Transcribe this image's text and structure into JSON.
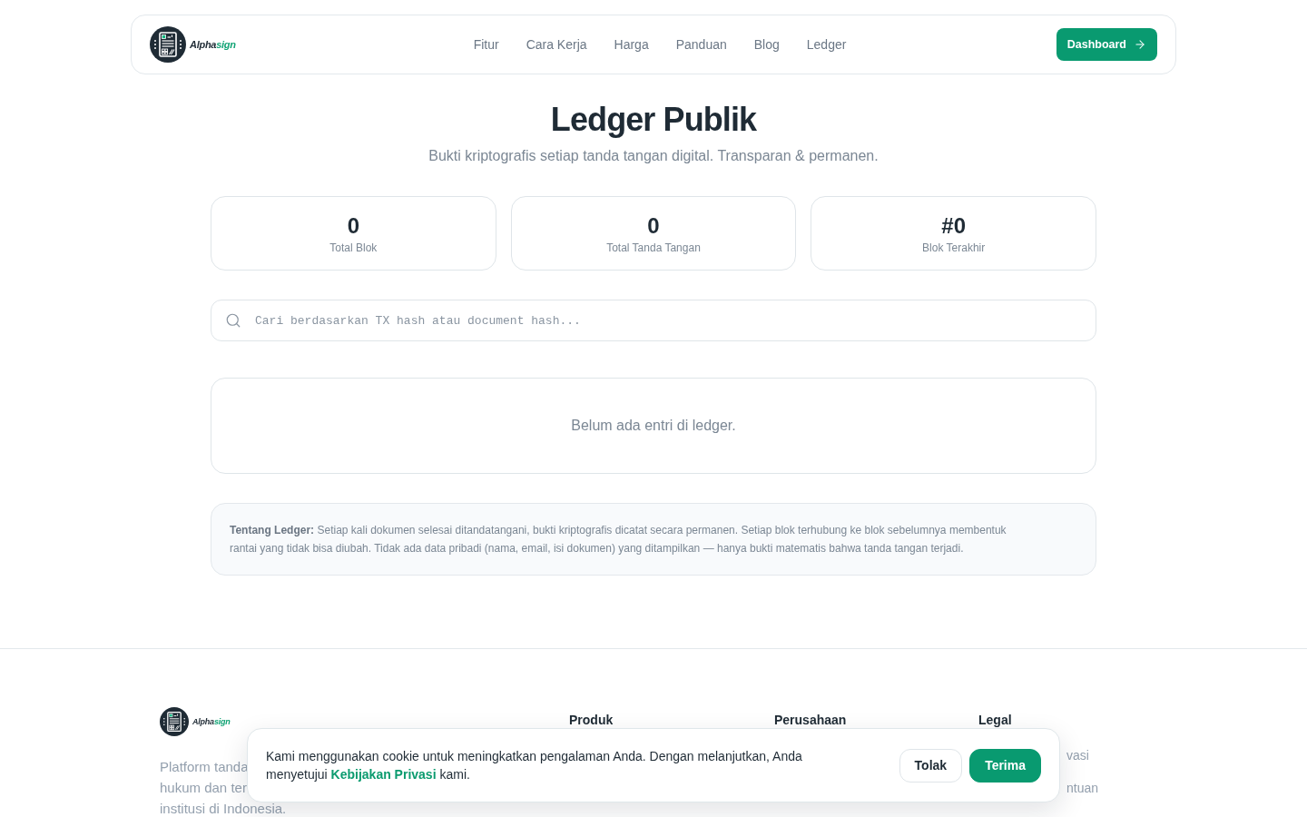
{
  "header": {
    "logo": {
      "name": "Alpha",
      "accent": "sign"
    },
    "nav": [
      {
        "label": "Fitur"
      },
      {
        "label": "Cara Kerja"
      },
      {
        "label": "Harga"
      },
      {
        "label": "Panduan"
      },
      {
        "label": "Blog"
      },
      {
        "label": "Ledger"
      }
    ],
    "cta": "Dashboard"
  },
  "hero": {
    "title": "Ledger Publik",
    "subtitle": "Bukti kriptografis setiap tanda tangan digital. Transparan & permanen."
  },
  "stats": [
    {
      "value": "0",
      "label": "Total Blok"
    },
    {
      "value": "0",
      "label": "Total Tanda Tangan"
    },
    {
      "value": "#0",
      "label": "Blok Terakhir"
    }
  ],
  "search": {
    "placeholder": "Cari berdasarkan TX hash atau document hash..."
  },
  "ledger": {
    "empty_message": "Belum ada entri di ledger."
  },
  "about": {
    "text": "**Tentang Ledger:** Setiap kali dokumen selesai ditandatangani, bukti kriptografis dicatat secara permanen. Setiap blok terhubung ke blok sebelumnya membentuk rantai yang tidak bisa diubah. Tidak ada data pribadi (nama, email, isi dokumen) yang ditampilkan — hanya bukti matematis bahwa tanda tangan terjadi."
  },
  "footer": {
    "logo": {
      "name": "Alpha",
      "accent": "sign"
    },
    "description_lines": [
      "Platform tanda",
      "hukum dan ter",
      "institusi di Indonesia."
    ],
    "columns": [
      {
        "heading": "Produk"
      },
      {
        "heading": "Perusahaan"
      },
      {
        "heading": "Legal",
        "links": [
          {
            "label": "vasi",
            "covered_by_banner": true
          },
          {
            "label": "ntuan",
            "covered_by_banner": true
          }
        ]
      }
    ]
  },
  "cookie_banner": {
    "text_before": "Kami menggunakan cookie untuk meningkatkan pengalaman Anda. Dengan melanjutkan, Anda menyetujui",
    "link": "Kebijakan Privasi",
    "text_after": "kami.",
    "buttons": [
      {
        "label": "Tolak",
        "kind": "secondary"
      },
      {
        "label": "Terima",
        "kind": "primary"
      }
    ]
  }
}
